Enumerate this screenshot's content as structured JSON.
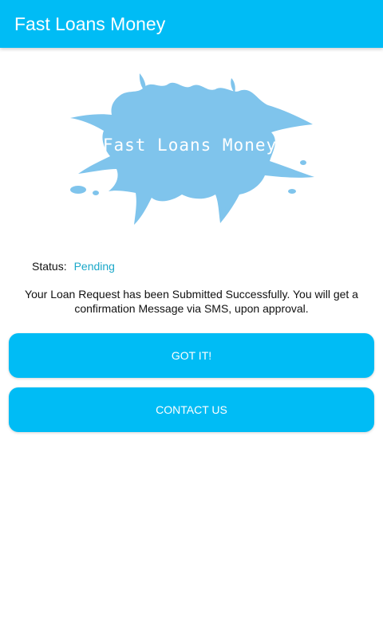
{
  "app_bar": {
    "title": "Fast Loans Money",
    "color": "#00bcf5"
  },
  "logo": {
    "text": "Fast Loans Money",
    "splash_color": "#7fc4ec"
  },
  "status": {
    "label": "Status:",
    "value": "Pending",
    "value_color": "#1ba8c9"
  },
  "message": "Your Loan Request has been Submitted Successfully. You will get a confirmation Message via SMS, upon approval.",
  "buttons": {
    "got_it": "GOT IT!",
    "contact_us": "CONTACT US"
  }
}
